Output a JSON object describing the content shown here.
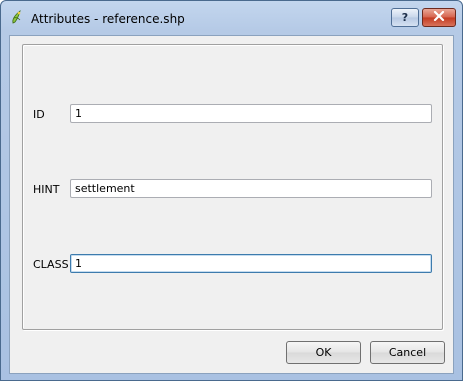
{
  "window": {
    "title": "Attributes - reference.shp",
    "help_label": "?",
    "close_label": "✕"
  },
  "fields": [
    {
      "label": "ID",
      "value": "1"
    },
    {
      "label": "HINT",
      "value": "settlement"
    },
    {
      "label": "CLASS",
      "value": "1"
    }
  ],
  "buttons": {
    "ok_label": "OK",
    "cancel_label": "Cancel"
  }
}
